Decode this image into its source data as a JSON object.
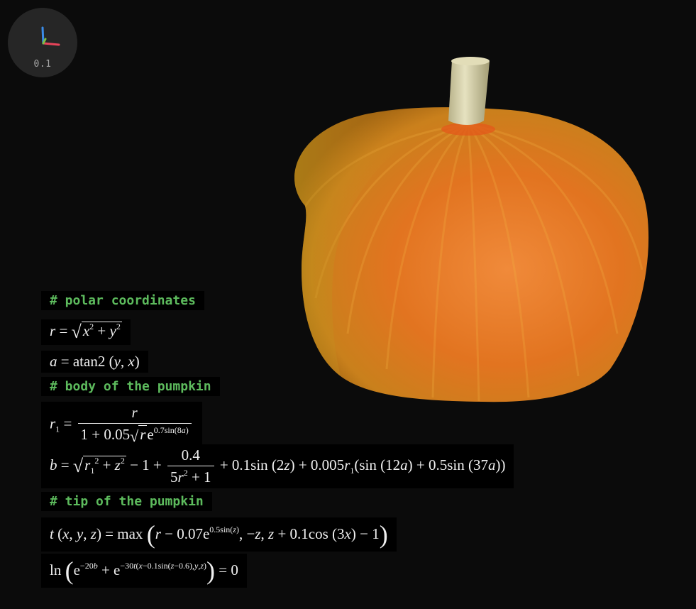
{
  "gizmo": {
    "scale_label": "0.1",
    "colors": {
      "x": "#e8445a",
      "y": "#3b8ce8",
      "z": "#7bc043"
    }
  },
  "scene": {
    "description_colors": {
      "body": "#e07a1c",
      "stem": "#d8d4a8",
      "background": "#0b0b0b"
    }
  },
  "equations": {
    "comment_polar": "# polar coordinates",
    "comment_body": "# body of the pumpkin",
    "comment_tip": "# tip of the pumpkin",
    "r_def": "r = √(x² + y²)",
    "a_def": "a = atan2 (y, x)",
    "r1_def": "r₁ = r / (1 + 0.05√r e^(0.7sin(8a)))",
    "b_def": "b = √(r₁² + z²) − 1 + 0.4/(5r² + 1) + 0.1sin (2z) + 0.005r₁(sin (12a) + 0.5sin (37a))",
    "t_def": "t (x, y, z) = max (r − 0.07e^(0.5sin(z)), −z, z + 0.1cos (3x) − 1)",
    "final_def": "ln (e^(−20b) + e^(−30t(x−0.1sin(z−0.6),y,z))) = 0"
  }
}
